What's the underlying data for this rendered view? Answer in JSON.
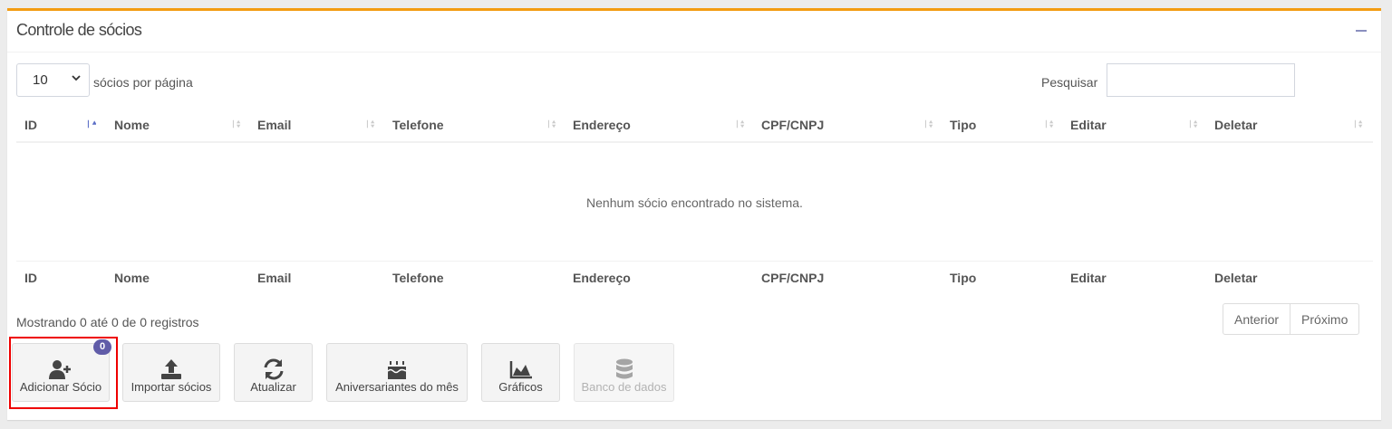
{
  "box": {
    "title": "Controle de sócios",
    "accent_color": "#f39c12",
    "collapse_icon": "minus-icon"
  },
  "controls": {
    "page_length_value": "10",
    "page_length_label": "sócios por página",
    "search_label": "Pesquisar",
    "search_value": ""
  },
  "table": {
    "columns": [
      "ID",
      "Nome",
      "Email",
      "Telefone",
      "Endereço",
      "CPF/CNPJ",
      "Tipo",
      "Editar",
      "Deletar"
    ],
    "empty_message": "Nenhum sócio encontrado no sistema.",
    "sorted_column": "ID",
    "sort_direction": "asc"
  },
  "footer": {
    "info": "Mostrando 0 até 0 de 0 registros",
    "prev_label": "Anterior",
    "next_label": "Próximo"
  },
  "actions": [
    {
      "label": "Adicionar Sócio",
      "icon": "user-plus-icon",
      "badge": "0",
      "enabled": true,
      "highlighted": true
    },
    {
      "label": "Importar sócios",
      "icon": "upload-icon",
      "enabled": true
    },
    {
      "label": "Atualizar",
      "icon": "refresh-icon",
      "enabled": true
    },
    {
      "label": "Aniversariantes do mês",
      "icon": "birthday-cake-icon",
      "enabled": true
    },
    {
      "label": "Gráficos",
      "icon": "area-chart-icon",
      "enabled": true
    },
    {
      "label": "Banco de dados",
      "icon": "database-icon",
      "enabled": false
    }
  ],
  "colors": {
    "badge": "#605ca8",
    "highlight_border": "#e00000",
    "button_bg": "#f4f4f4"
  }
}
